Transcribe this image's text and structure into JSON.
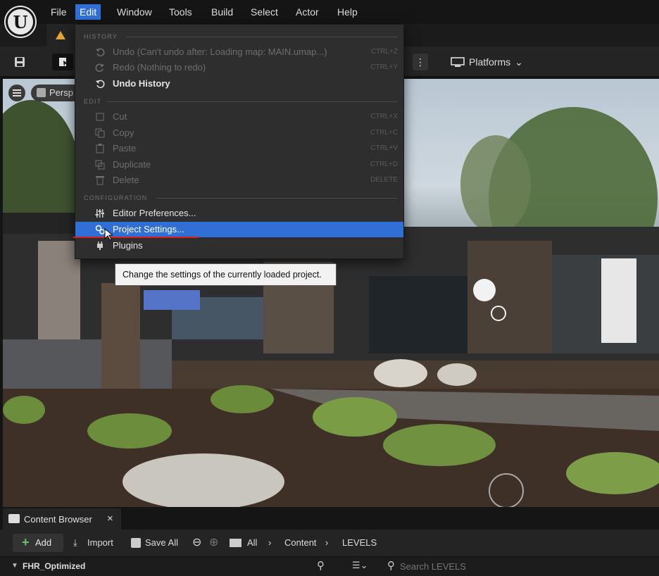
{
  "menubar": {
    "items": [
      "File",
      "Edit",
      "Window",
      "Tools",
      "Build",
      "Select",
      "Actor",
      "Help"
    ],
    "active": "Edit"
  },
  "toolbar": {
    "platforms_label": "Platforms"
  },
  "viewport": {
    "view_mode": "Persp"
  },
  "edit_menu": {
    "sections": {
      "history": "HISTORY",
      "edit": "EDIT",
      "configuration": "CONFIGURATION"
    },
    "items": [
      {
        "label": "Undo (Can't undo after: Loading map: MAIN.umap...)",
        "shortcut": "CTRL+Z",
        "icon": "undo-icon",
        "enabled": false
      },
      {
        "label": "Redo (Nothing to redo)",
        "shortcut": "CTRL+Y",
        "icon": "redo-icon",
        "enabled": false
      },
      {
        "label": "Undo History",
        "shortcut": "",
        "icon": "undo-history-icon",
        "enabled": true
      },
      {
        "label": "Cut",
        "shortcut": "CTRL+X",
        "icon": "cut-icon",
        "enabled": false
      },
      {
        "label": "Copy",
        "shortcut": "CTRL+C",
        "icon": "copy-icon",
        "enabled": false
      },
      {
        "label": "Paste",
        "shortcut": "CTRL+V",
        "icon": "paste-icon",
        "enabled": false
      },
      {
        "label": "Duplicate",
        "shortcut": "CTRL+D",
        "icon": "duplicate-icon",
        "enabled": false
      },
      {
        "label": "Delete",
        "shortcut": "DELETE",
        "icon": "delete-icon",
        "enabled": false
      },
      {
        "label": "Editor Preferences...",
        "shortcut": "",
        "icon": "sliders-icon",
        "enabled": true
      },
      {
        "label": "Project Settings...",
        "shortcut": "",
        "icon": "gears-icon",
        "enabled": true,
        "highlighted": true
      },
      {
        "label": "Plugins",
        "shortcut": "",
        "icon": "plug-icon",
        "enabled": true
      }
    ],
    "tooltip": "Change the settings of the currently loaded project."
  },
  "content_browser": {
    "tab_label": "Content Browser",
    "close": "×",
    "add_label": "Add",
    "import_label": "Import",
    "save_all_label": "Save All",
    "path": [
      "All",
      "Content",
      "LEVELS"
    ],
    "tree_root": "FHR_Optimized",
    "search_placeholder": "Search LEVELS"
  },
  "colors": {
    "accent": "#2f6fd6",
    "underline": "#d42020",
    "menu_bg": "#2e2e2e"
  }
}
